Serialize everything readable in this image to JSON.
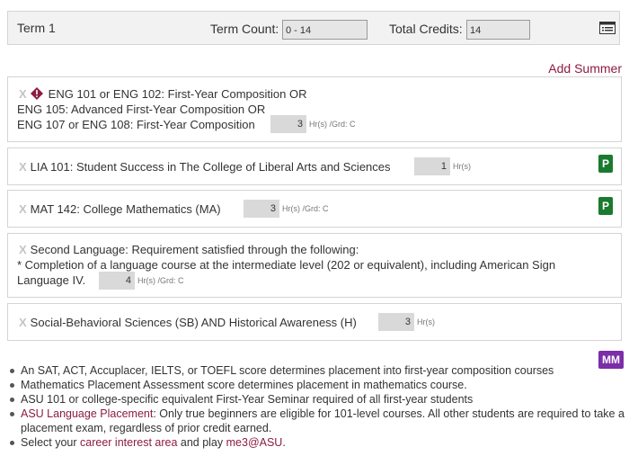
{
  "header": {
    "term_title": "Term 1",
    "term_count_label": "Term Count:",
    "term_count_value": "0 - 14",
    "total_credits_label": "Total Credits:",
    "total_credits_value": "14",
    "menu_icon": "list-icon"
  },
  "add_summer_label": "Add Summer",
  "courses": [
    {
      "remove_icon": "X",
      "alert_icon": "alert-icon",
      "lines": [
        "ENG 101 or ENG 102: First-Year Composition OR",
        "ENG 105: Advanced First-Year Composition OR",
        "ENG 107 or ENG 108: First-Year Composition"
      ],
      "hours": "3",
      "suffix": "Hr(s) /Grd: C"
    },
    {
      "remove_icon": "X",
      "title": "LIA 101: Student Success in The College of Liberal Arts and Sciences",
      "hours": "1",
      "suffix": "Hr(s)",
      "badge": "P"
    },
    {
      "remove_icon": "X",
      "title": "MAT 142: College Mathematics (MA)",
      "hours": "3",
      "suffix": "Hr(s) /Grd: C",
      "badge": "P"
    },
    {
      "remove_icon": "X",
      "lines": [
        "Second Language: Requirement satisfied through the following:",
        "* Completion of a language course at the intermediate level (202 or equivalent), including American Sign",
        "Language IV."
      ],
      "hours": "4",
      "suffix": "Hr(s) /Grd: C"
    },
    {
      "remove_icon": "X",
      "title": "Social-Behavioral Sciences (SB) AND Historical Awareness (H)",
      "hours": "3",
      "suffix": "Hr(s)"
    }
  ],
  "notes_badge": "MM",
  "notes": {
    "n1": "An SAT, ACT, Accuplacer, IELTS, or TOEFL score determines placement into first-year composition courses",
    "n2": "Mathematics Placement Assessment score determines placement in mathematics course.",
    "n3": "ASU 101 or college-specific equivalent First-Year Seminar required of all first-year students",
    "n4_link": "ASU Language Placement",
    "n4_text": ": Only true beginners are eligible for 101-level courses. All other students are required to take a placement exam, regardless of prior credit earned.",
    "n5_pre": "Select your ",
    "n5_link1": "career interest area",
    "n5_mid": " and play ",
    "n5_link2": "me3@ASU",
    "n5_post": "."
  },
  "colors": {
    "link": "#8c1d40",
    "badge_p": "#1a7a2e",
    "badge_mm": "#7b2ea8",
    "alert": "#8c1d40"
  }
}
